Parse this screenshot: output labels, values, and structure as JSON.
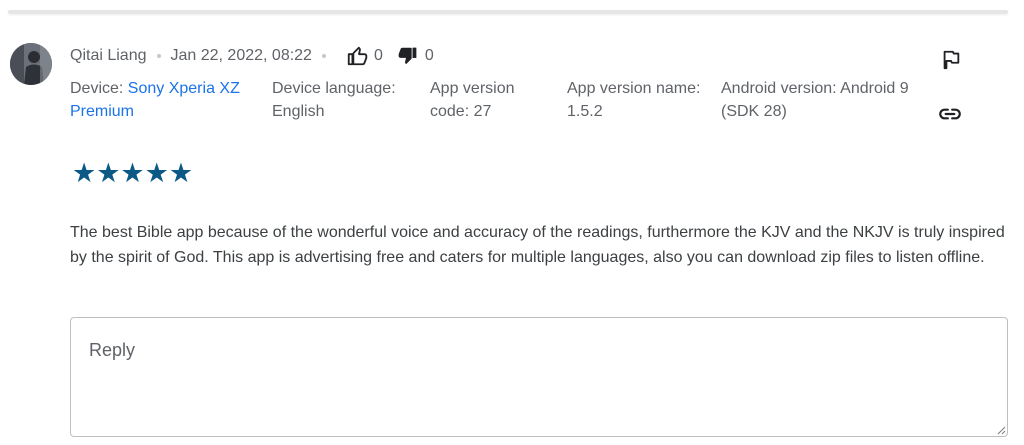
{
  "review": {
    "author": "Qitai Liang",
    "date": "Jan 22, 2022, 08:22",
    "upvotes": "0",
    "downvotes": "0",
    "device_label": "Device: ",
    "device_value": "Sony Xperia XZ Premium",
    "language_label": "Device language:",
    "language_value": "English",
    "version_code_label": "App version code: 27",
    "version_name_label": "App version name: 1.5.2",
    "android_version": "Android version: Android 9 (SDK 28)",
    "rating": 5,
    "stars": "★★★★★",
    "text": "The best Bible app because of the wonderful voice and accuracy of the readings, furthermore the KJV and the NKJV is truly inspired by the spirit of God. This app is advertising free and caters for multiple languages, also you can download zip files to listen offline."
  },
  "reply": {
    "placeholder": "Reply"
  },
  "colors": {
    "link": "#1a73e8",
    "star": "#0b5a86",
    "text": "#3c4043",
    "meta": "#5f6368"
  },
  "icons": [
    "thumb-up-icon",
    "thumb-down-icon",
    "flag-icon",
    "link-icon"
  ]
}
